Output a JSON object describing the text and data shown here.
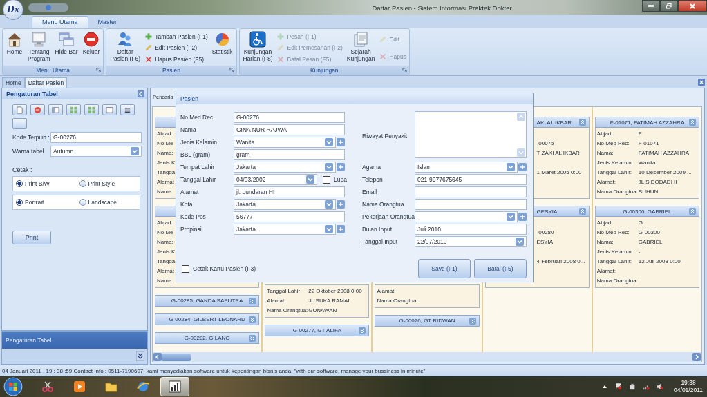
{
  "window": {
    "logo": "Dx",
    "title": "Daftar Pasien - Sistem Informasi Praktek Dokter"
  },
  "ribbon": {
    "tabs": [
      {
        "label": "Menu Utama",
        "selected": true
      },
      {
        "label": "Master",
        "selected": false
      }
    ],
    "groups": [
      {
        "label": "Menu Utama",
        "items": [
          {
            "kind": "large",
            "label": "Home",
            "disabled": false
          },
          {
            "kind": "large",
            "label": "Tentang\nProgram",
            "disabled": false
          },
          {
            "kind": "large",
            "label": "Hide Bar",
            "disabled": false
          },
          {
            "kind": "large",
            "label": "Keluar",
            "disabled": false
          }
        ]
      },
      {
        "label": "Pasien",
        "items": [
          {
            "kind": "large",
            "label": "Daftar\nPasien (F6)",
            "disabled": false
          },
          {
            "kind": "small",
            "label": "Tambah Pasien (F1)",
            "disabled": false
          },
          {
            "kind": "small",
            "label": "Edit Pasien (F2)",
            "disabled": false
          },
          {
            "kind": "small",
            "label": "Hapus Pasien (F5)",
            "disabled": false
          },
          {
            "kind": "large",
            "label": "Statistik",
            "disabled": false
          }
        ]
      },
      {
        "label": "Kunjungan",
        "items": [
          {
            "kind": "large",
            "label": "Kunjungan\nHarian (F8)",
            "disabled": false
          },
          {
            "kind": "small",
            "label": "Pesan (F1)",
            "disabled": true
          },
          {
            "kind": "small",
            "label": "Edit Pemesanan (F2)",
            "disabled": true
          },
          {
            "kind": "small",
            "label": "Batal Pesan (F5)",
            "disabled": true
          },
          {
            "kind": "large",
            "label": "Sejarah\nKunjungan",
            "disabled": false
          },
          {
            "kind": "small",
            "label": "Edit",
            "disabled": true
          },
          {
            "kind": "small",
            "label": "Hapus",
            "disabled": true
          }
        ]
      }
    ]
  },
  "doc_tabs": [
    {
      "label": "Home",
      "selected": false
    },
    {
      "label": "Daftar Pasien",
      "selected": true
    }
  ],
  "side_panel": {
    "title": "Pengaturan Tabel",
    "fields": [
      {
        "kind": "text",
        "label": "Kode Terpilih :",
        "value": "G-00276"
      },
      {
        "kind": "combo",
        "label": "Warna tabel",
        "value": "Autumn"
      }
    ],
    "print_label": "Cetak :",
    "option_groups": [
      [
        {
          "label": "Print B/W",
          "selected": true
        },
        {
          "label": "Print Style",
          "selected": false
        }
      ],
      [
        {
          "label": "Portrait",
          "selected": true
        },
        {
          "label": "Landscape",
          "selected": false
        }
      ]
    ],
    "print_button": "Print",
    "nav_item": {
      "label": "Pengaturan Tabel",
      "selected": true
    }
  },
  "content": {
    "search_label": "Pencaria",
    "columns": [
      [
        {
          "kind": "left",
          "rows": [
            {
              "label": "Abjad:"
            },
            {
              "label": "No Me"
            },
            {
              "label": "Nama:"
            },
            {
              "label": "Jenis K"
            },
            {
              "label": "Tangga"
            },
            {
              "label": "Alamat"
            },
            {
              "label": "Nama"
            }
          ]
        },
        {
          "kind": "left",
          "rows": [
            {
              "label": "Abjad:"
            },
            {
              "label": "No Me"
            },
            {
              "label": "Nama:"
            },
            {
              "label": "Jenis K"
            },
            {
              "label": "Tangga"
            },
            {
              "label": "Alamat"
            },
            {
              "label": "Nama"
            }
          ]
        },
        {
          "kind": "collapsed",
          "header": "G-00285, GANDA SAPUTRA"
        },
        {
          "kind": "collapsed",
          "header": "G-00284, GILBERT LEONARD"
        },
        {
          "kind": "collapsed",
          "header": "G-00282, GILANG"
        }
      ],
      [
        {
          "kind": "partial",
          "rows": [
            {
              "label": "Tanggal Lahir:",
              "value": "22 Oktober 2008 0:00"
            },
            {
              "label": "Alamat:",
              "value": "JL SUKA RAMAI"
            },
            {
              "label": "Nama Orangtua:",
              "value": "GUNAWAN"
            }
          ]
        },
        {
          "kind": "collapsed",
          "header": "G-00277, GT ALIFA"
        }
      ],
      [
        {
          "kind": "partial",
          "rows": [
            {
              "label": "Alamat:"
            },
            {
              "label": "Nama Orangtua:"
            }
          ]
        },
        {
          "kind": "collapsed",
          "header": "G-00076, GT RIDWAN"
        }
      ],
      [
        {
          "kind": "right",
          "header": "AKI AL IKBAR",
          "rows": [
            {},
            {
              "value": "-00075"
            },
            {
              "value": "T ZAKI AL IKBAR"
            },
            {},
            {
              "value": "1 Maret 2005 0:00"
            },
            {},
            {}
          ]
        },
        {
          "kind": "right",
          "header": "GESYIA",
          "rows": [
            {},
            {
              "value": "-00280"
            },
            {
              "value": "ESYIA"
            },
            {},
            {
              "value": "4 Februari 2008 0..."
            },
            {},
            {}
          ]
        }
      ],
      [
        {
          "kind": "full",
          "header": "F-01071, FATIMAH AZZAHRA",
          "rows": [
            {
              "label": "Abjad:",
              "value": "F"
            },
            {
              "label": "No Med Rec:",
              "value": "F-01071"
            },
            {
              "label": "Nama:",
              "value": "FATIMAH AZZAHRA"
            },
            {
              "label": "Jenis Kelamin:",
              "value": "Wanita"
            },
            {
              "label": "Tanggal Lahir:",
              "value": "10 Desember 2009 ..."
            },
            {
              "label": "Alamat:",
              "value": "JL SIDODADI II"
            },
            {
              "label": "Nama Orangtua:",
              "value": "SUHUN"
            }
          ]
        },
        {
          "kind": "full",
          "header": "G-00300, GABRIEL",
          "rows": [
            {
              "label": "Abjad:",
              "value": "G"
            },
            {
              "label": "No Med Rec:",
              "value": "G-00300"
            },
            {
              "label": "Nama:",
              "value": "GABRIEL"
            },
            {
              "label": "Jenis Kelamin:",
              "value": "-"
            },
            {
              "label": "Tanggal Lahir:",
              "value": "12 Juli 2008 0:00"
            },
            {
              "label": "Alamat:"
            },
            {
              "label": "Nama Orangtua:"
            }
          ]
        }
      ]
    ]
  },
  "dialog": {
    "title": "Pasien",
    "left_fields": [
      {
        "kind": "text",
        "label": "No Med Rec",
        "value": "G-00276"
      },
      {
        "kind": "text",
        "label": "Nama",
        "value": "GINA NUR RAJWA"
      },
      {
        "kind": "combo",
        "label": "Jenis Kelamin",
        "value": "Wanita"
      },
      {
        "kind": "text",
        "label": "BBL (gram)",
        "value": "gram"
      },
      {
        "kind": "combo",
        "label": "Tempat Lahir",
        "value": "Jakarta"
      },
      {
        "kind": "date",
        "label": "Tanggal Lahir",
        "value": "04/03/2002",
        "checkbox": {
          "label": "Lupa",
          "checked": false
        }
      },
      {
        "kind": "text",
        "label": "Alamat",
        "value": "jl. bundaran HI"
      },
      {
        "kind": "combo",
        "label": "Kota",
        "value": "Jakarta"
      },
      {
        "kind": "text",
        "label": "Kode Pos",
        "value": "56777"
      },
      {
        "kind": "combo",
        "label": "Propinsi",
        "value": "Jakarta"
      }
    ],
    "right_fields": [
      {
        "kind": "memo",
        "label": "Riwayat Penyakit"
      },
      {
        "kind": "combo",
        "label": "Agama",
        "value": "Islam"
      },
      {
        "kind": "text",
        "label": "Telepon",
        "value": "021-9977675645"
      },
      {
        "kind": "text",
        "label": "Email"
      },
      {
        "kind": "text",
        "label": "Nama Orangtua"
      },
      {
        "kind": "combo",
        "label": "Pekerjaan Orangtua",
        "value": "-"
      },
      {
        "kind": "text",
        "label": "Bulan Input",
        "value": "Juli 2010"
      },
      {
        "kind": "date",
        "label": "Tanggal Input",
        "value": "22/07/2010"
      }
    ],
    "print_card": {
      "label": "Cetak Kartu Pasien (F3)",
      "checked": false
    },
    "buttons": [
      "Save (F1)",
      "Batal (F5)"
    ]
  },
  "status_bar": "04 Januari 2011 , 19 : 38 :59  Contact Info : 0511-7190607, kami menyediakan software untuk kepentingan bisnis anda, \"with our software, manage your bussiness in minute\"",
  "taskbar": {
    "time": "19:38",
    "date": "04/01/2011"
  }
}
